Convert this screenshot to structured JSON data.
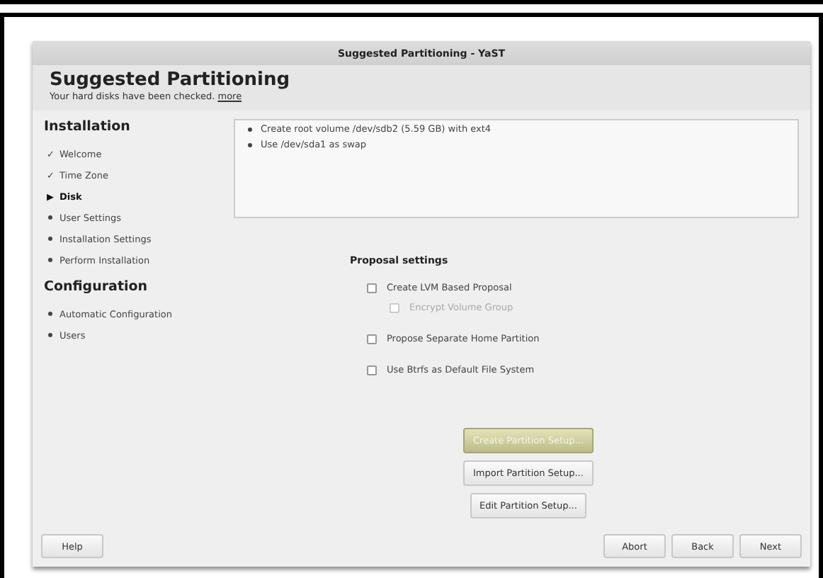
{
  "window": {
    "title": "Suggested Partitioning - YaST"
  },
  "header": {
    "title": "Suggested Partitioning",
    "subtitle": "Your hard disks have been checked.",
    "link": "more"
  },
  "sidebar": {
    "sections": [
      {
        "title": "Installation",
        "items": [
          {
            "label": "Welcome",
            "marker": "✓",
            "current": false
          },
          {
            "label": "Time Zone",
            "marker": "✓",
            "current": false
          },
          {
            "label": "Disk",
            "marker": "▶",
            "current": true
          },
          {
            "label": "User Settings",
            "current": false
          },
          {
            "label": "Installation Settings",
            "current": false
          },
          {
            "label": "Perform Installation",
            "current": false
          }
        ]
      },
      {
        "title": "Configuration",
        "items": [
          {
            "label": "Automatic Configuration",
            "current": false
          },
          {
            "label": "Users",
            "current": false
          }
        ]
      }
    ]
  },
  "summary": [
    "Create root volume /dev/sdb2 (5.59 GB) with ext4",
    "Use /dev/sda1 as swap"
  ],
  "proposal_settings": {
    "title": "Proposal settings",
    "options": [
      {
        "label": "Create LVM Based Proposal",
        "checked": false,
        "disabled": false,
        "children": [
          {
            "label": "Encrypt Volume Group",
            "checked": false,
            "disabled": true
          }
        ]
      },
      {
        "label": "Propose Separate Home Partition",
        "checked": false,
        "disabled": false
      },
      {
        "label": "Use Btrfs as Default File System",
        "checked": false,
        "disabled": false
      }
    ]
  },
  "setup_buttons": [
    {
      "label": "Create Partition Setup...",
      "hovered": true
    },
    {
      "label": "Import Partition Setup...",
      "hovered": false
    },
    {
      "label": "Edit Partition Setup...",
      "hovered": false
    }
  ],
  "footer": {
    "help": "Help",
    "buttons": [
      "Abort",
      "Back",
      "Next"
    ]
  }
}
